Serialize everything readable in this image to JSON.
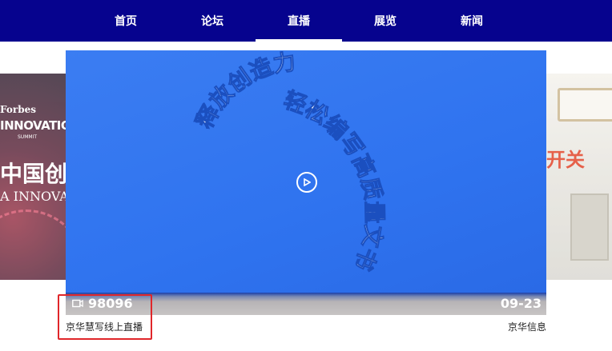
{
  "nav": {
    "items": [
      {
        "label": "首页"
      },
      {
        "label": "论坛"
      },
      {
        "label": "直播",
        "active": true
      },
      {
        "label": "展览"
      },
      {
        "label": "新闻"
      }
    ]
  },
  "carousel": {
    "left_slide": {
      "brand": "Forbes",
      "innovation": "INNOVATION",
      "summit": "SUMMIT",
      "headline": "中国创",
      "sub": "A INNOVA"
    },
    "right_slide": {
      "tag": "开关"
    },
    "active_slide": {
      "cover_text_line1": "释放创造力",
      "cover_text_line2": "轻松编写高质量文书",
      "views": "98096",
      "date": "09-23",
      "title": "京华慧写线上直播",
      "publisher": "京华信息"
    }
  },
  "colors": {
    "nav_bg": "#06038e",
    "cover_bg": "#2f73ef",
    "highlight_border": "#e0262a"
  },
  "icons": {
    "view_count": "video-camera-icon",
    "play": "play-circle-icon"
  }
}
